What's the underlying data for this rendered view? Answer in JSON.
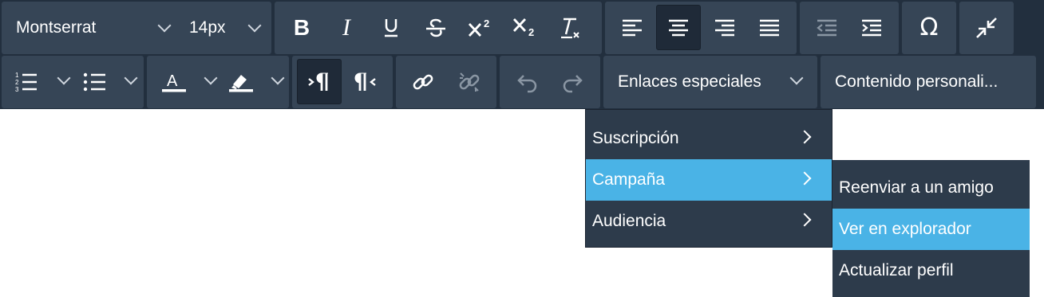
{
  "toolbar": {
    "font_family": "Montserrat",
    "font_size": "14px",
    "special_links_label": "Enlaces especiales",
    "custom_content_label": "Contenido personali..."
  },
  "menu": {
    "items": [
      {
        "label": "Suscripción"
      },
      {
        "label": "Campaña"
      },
      {
        "label": "Audiencia"
      }
    ]
  },
  "submenu": {
    "items": [
      {
        "label": "Reenviar a un amigo"
      },
      {
        "label": "Ver en explorador"
      },
      {
        "label": "Actualizar perfil"
      }
    ]
  },
  "colors": {
    "toolbar_bg": "#222f3e",
    "group_bg": "#364556",
    "menu_bg": "#2d3b4b",
    "highlight": "#4ab3e6"
  }
}
